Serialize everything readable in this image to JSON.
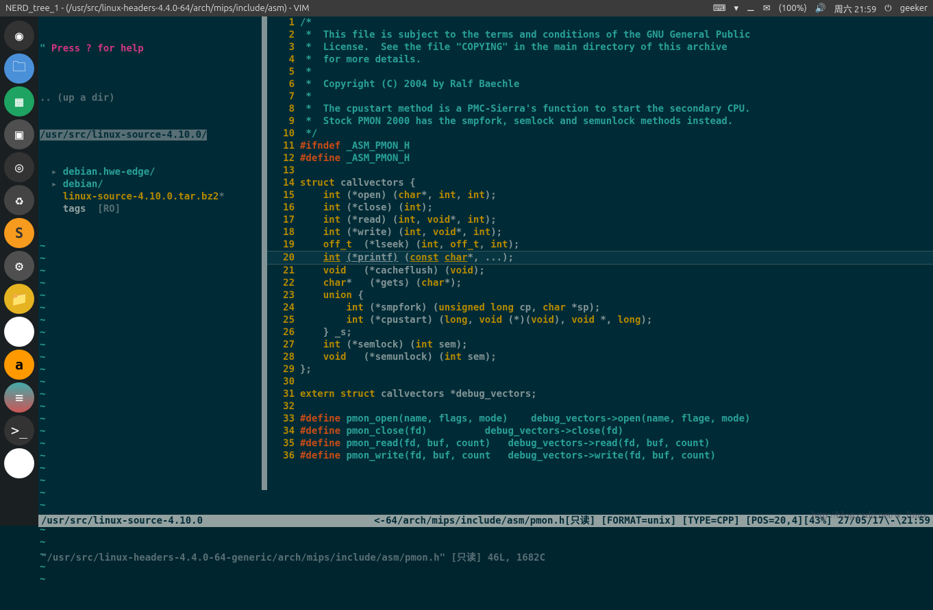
{
  "topbar": {
    "title": "NERD_tree_1 - (/usr/src/linux-headers-4.4.0-64/arch/mips/include/asm) - VIM",
    "battery": "(100%)",
    "date": "周六 21:59",
    "user": "geeker"
  },
  "tree": {
    "help_prefix": "\" ",
    "help": "Press ? for help",
    "updir": ".. (up a dir)",
    "selected": "/usr/src/linux-source-4.10.0/",
    "items": [
      {
        "arrow": "▸",
        "name": "debian.hwe-edge/",
        "type": "dir"
      },
      {
        "arrow": "▸",
        "name": "debian/",
        "type": "dir"
      },
      {
        "arrow": " ",
        "name": "linux-source-4.10.0.tar.bz2",
        "type": "exe",
        "suffix": "*"
      },
      {
        "arrow": " ",
        "name": "tags",
        "type": "file",
        "suffix": "  [RO]"
      }
    ]
  },
  "code_lines": [
    {
      "n": 1,
      "html": "<span class='c-cm'>/*</span>"
    },
    {
      "n": 2,
      "html": "<span class='c-cm'> *  This file is subject to the terms and conditions of the GNU General Public</span>"
    },
    {
      "n": 3,
      "html": "<span class='c-cm'> *  License.  See the file \"COPYING\" in the main directory of this archive</span>"
    },
    {
      "n": 4,
      "html": "<span class='c-cm'> *  for more details.</span>"
    },
    {
      "n": 5,
      "html": "<span class='c-cm'> *</span>"
    },
    {
      "n": 6,
      "html": "<span class='c-cm'> *  Copyright (C) 2004 by Ralf Baechle</span>"
    },
    {
      "n": 7,
      "html": "<span class='c-cm'> *</span>"
    },
    {
      "n": 8,
      "html": "<span class='c-cm'> *  The cpustart method is a PMC-Sierra's function to start the secondary CPU.</span>"
    },
    {
      "n": 9,
      "html": "<span class='c-cm'> *  Stock PMON 2000 has the smpfork, semlock and semunlock methods instead.</span>"
    },
    {
      "n": 10,
      "html": "<span class='c-cm'> */</span>"
    },
    {
      "n": 11,
      "html": "<span class='c-pp'>#ifndef</span> <span class='c-nm'>_ASM_PMON_H</span>"
    },
    {
      "n": 12,
      "html": "<span class='c-pp'>#define</span> <span class='c-nm'>_ASM_PMON_H</span>"
    },
    {
      "n": 13,
      "html": " "
    },
    {
      "n": 14,
      "html": "<span class='c-kw'>struct</span> <span class='c-id'>callvectors {</span>"
    },
    {
      "n": 15,
      "html": "    <span class='c-ty'>int</span> <span class='c-id'>(*open) (</span><span class='c-ty'>char</span><span class='c-id'>*, </span><span class='c-ty'>int</span><span class='c-id'>, </span><span class='c-ty'>int</span><span class='c-id'>);</span>"
    },
    {
      "n": 16,
      "html": "    <span class='c-ty'>int</span> <span class='c-id'>(*close) (</span><span class='c-ty'>int</span><span class='c-id'>);</span>"
    },
    {
      "n": 17,
      "html": "    <span class='c-ty'>int</span> <span class='c-id'>(*read) (</span><span class='c-ty'>int</span><span class='c-id'>, </span><span class='c-ty'>void</span><span class='c-id'>*, </span><span class='c-ty'>int</span><span class='c-id'>);</span>"
    },
    {
      "n": 18,
      "html": "    <span class='c-ty'>int</span> <span class='c-id'>(*write) (</span><span class='c-ty'>int</span><span class='c-id'>, </span><span class='c-ty'>void</span><span class='c-id'>*, </span><span class='c-ty'>int</span><span class='c-id'>);</span>"
    },
    {
      "n": 19,
      "html": "    <span class='c-ty'>off_t</span>  <span class='c-id'>(*lseek) (</span><span class='c-ty'>int</span><span class='c-id'>, </span><span class='c-ty'>off_t</span><span class='c-id'>, </span><span class='c-ty'>int</span><span class='c-id'>);</span>"
    },
    {
      "n": 20,
      "cur": true,
      "html": "    <span class='c-ty c-ul'>int</span> <span class='c-id c-ul'>(*printf)</span> <span class='c-id'>(</span><span class='c-ty c-ul'>const</span> <span class='c-ty c-ul'>char</span><span class='c-id'>*, ...);</span>"
    },
    {
      "n": 21,
      "html": "    <span class='c-ty'>void</span>   <span class='c-id'>(*cacheflush) (</span><span class='c-ty'>void</span><span class='c-id'>);</span>"
    },
    {
      "n": 22,
      "html": "    <span class='c-ty'>char</span><span class='c-id'>*   (*gets) (</span><span class='c-ty'>char</span><span class='c-id'>*);</span>"
    },
    {
      "n": 23,
      "html": "    <span class='c-kw'>union</span> <span class='c-id'>{</span>"
    },
    {
      "n": 24,
      "html": "        <span class='c-ty'>int</span> <span class='c-id'>(*smpfork) (</span><span class='c-ty'>unsigned long</span> <span class='c-id'>cp, </span><span class='c-ty'>char</span> <span class='c-id'>*sp);</span>"
    },
    {
      "n": 25,
      "html": "        <span class='c-ty'>int</span> <span class='c-id'>(*cpustart) (</span><span class='c-ty'>long</span><span class='c-id'>, </span><span class='c-ty'>void</span> <span class='c-id'>(*)(</span><span class='c-ty'>void</span><span class='c-id'>), </span><span class='c-ty'>void</span> <span class='c-id'>*, </span><span class='c-ty'>long</span><span class='c-id'>);</span>"
    },
    {
      "n": 26,
      "html": "    <span class='c-id'>} _s;</span>"
    },
    {
      "n": 27,
      "html": "    <span class='c-ty'>int</span> <span class='c-id'>(*semlock) (</span><span class='c-ty'>int</span> <span class='c-id'>sem);</span>"
    },
    {
      "n": 28,
      "html": "    <span class='c-ty'>void</span>   <span class='c-id'>(*semunlock) (</span><span class='c-ty'>int</span> <span class='c-id'>sem);</span>"
    },
    {
      "n": 29,
      "html": "<span class='c-id'>};</span>"
    },
    {
      "n": 30,
      "html": " "
    },
    {
      "n": 31,
      "html": "<span class='c-kw'>extern struct</span> <span class='c-id'>callvectors *debug_vectors;</span>"
    },
    {
      "n": 32,
      "html": " "
    },
    {
      "n": 33,
      "html": "<span class='c-pp'>#define</span> <span class='c-nm'>pmon_open(name, flags, mode)    debug_vectors->open(name, flage, mode)</span>"
    },
    {
      "n": 34,
      "html": "<span class='c-pp'>#define</span> <span class='c-nm'>pmon_close(fd)          debug_vectors->close(fd)</span>"
    },
    {
      "n": 35,
      "html": "<span class='c-pp'>#define</span> <span class='c-nm'>pmon_read(fd, buf, count)   debug_vectors->read(fd, buf, count)</span>"
    },
    {
      "n": 36,
      "html": "<span class='c-pp'>#define</span> <span class='c-nm'>pmon_write(fd, buf, count   debug_vectors->write(fd, buf, count)</span>"
    }
  ],
  "status": {
    "left": "/usr/src/linux-source-4.10.0",
    "mid": "<-64/arch/mips/include/asm/pmon.h[只读] [FORMAT=unix] [TYPE=CPP] [POS=20,4][43%] 27/05/17\\-\\21:59",
    "msg": "\"/usr/src/linux-headers-4.4.0-64-generic/arch/mips/include/asm/pmon.h\" [只读] 46L, 1682C"
  },
  "watermark": "http://blog.csdn.net/w_linux"
}
